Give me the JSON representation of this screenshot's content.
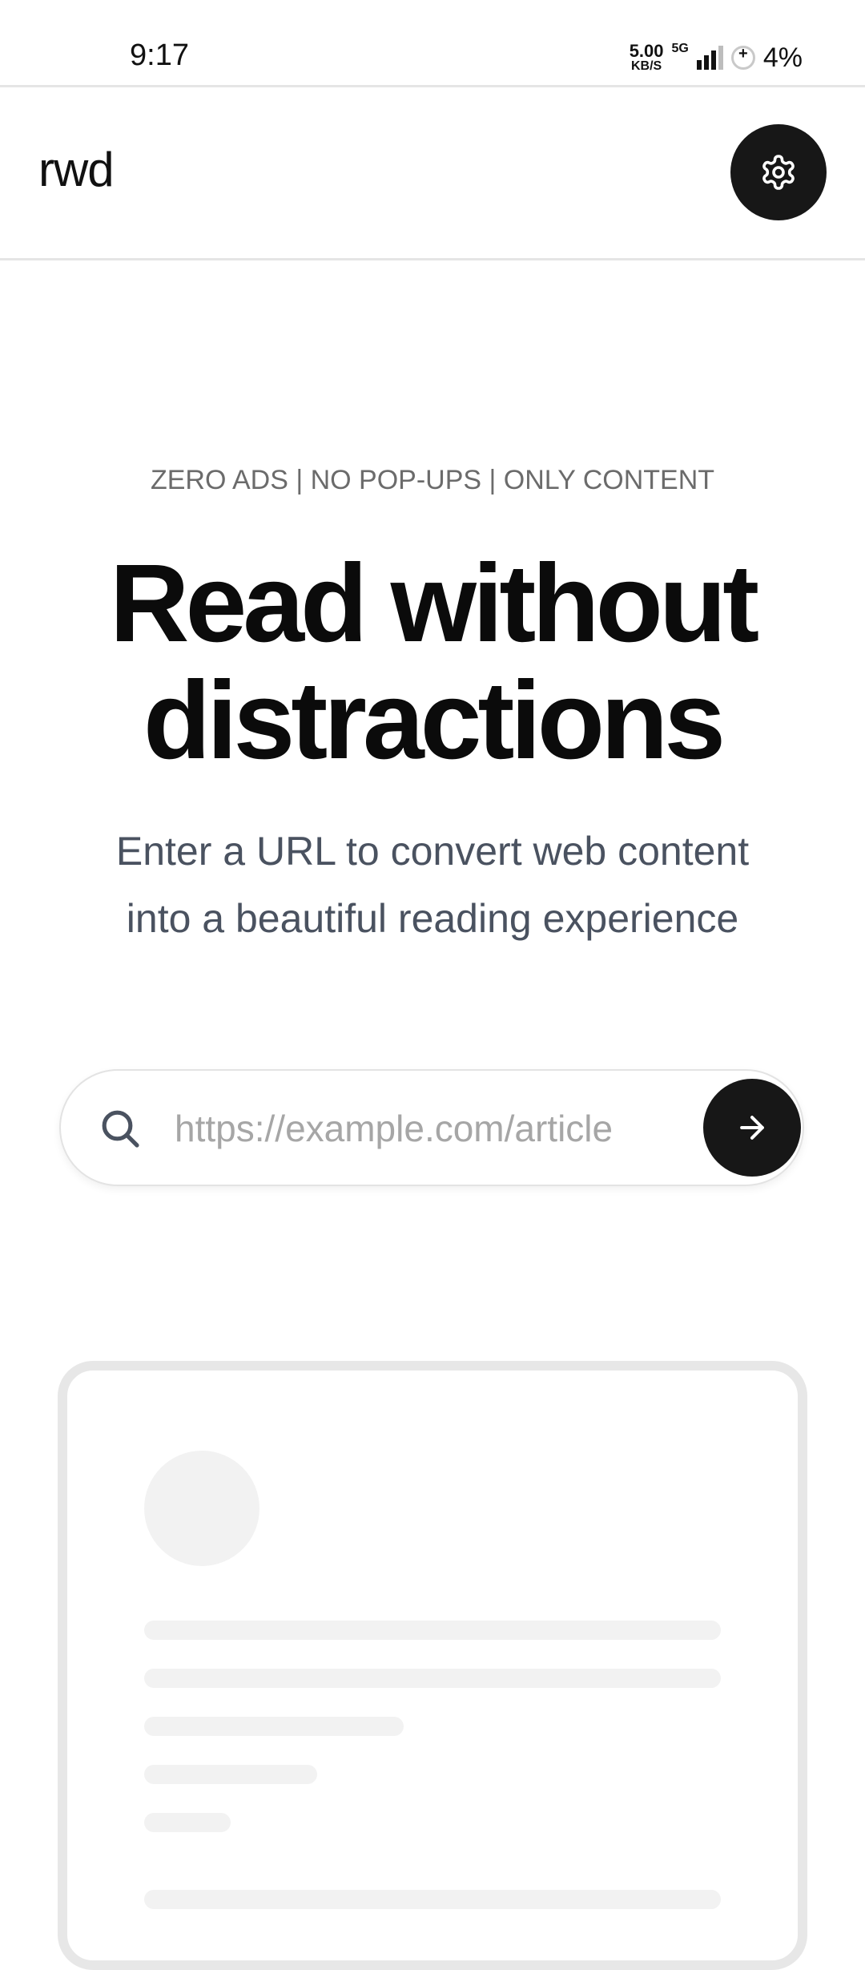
{
  "status_bar": {
    "time": "9:17",
    "net_speed_value": "5.00",
    "net_speed_unit": "KB/S",
    "network_type": "5G",
    "battery": "4%"
  },
  "header": {
    "logo": "rwd",
    "settings_icon": "gear-icon"
  },
  "hero": {
    "tagline": "ZERO ADS | NO POP-UPS | ONLY CONTENT",
    "title_line1": "Read without",
    "title_line2": "distractions",
    "subtitle_line1": "Enter a URL to convert web content",
    "subtitle_line2": "into a beautiful reading experience"
  },
  "search": {
    "placeholder": "https://example.com/article",
    "value": "",
    "search_icon": "search-icon",
    "submit_icon": "arrow-right-icon"
  },
  "colors": {
    "primary_dark": "#171717",
    "muted_text": "#6b6b6b",
    "subtitle_text": "#4a5260",
    "skeleton": "#f2f2f2",
    "card_border": "#e7e7e7"
  }
}
